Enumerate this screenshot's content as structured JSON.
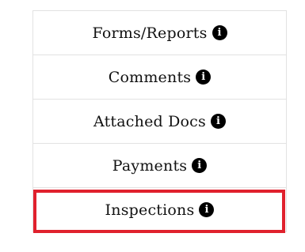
{
  "menu": {
    "items": [
      {
        "label": "Forms/Reports",
        "icon": "info-icon"
      },
      {
        "label": "Comments",
        "icon": "info-icon"
      },
      {
        "label": "Attached Docs",
        "icon": "info-icon"
      },
      {
        "label": "Payments",
        "icon": "info-icon"
      },
      {
        "label": "Inspections",
        "icon": "info-icon"
      }
    ],
    "info_glyph": "i",
    "highlight_color": "#e0212d",
    "highlighted_item": "Inspections"
  }
}
